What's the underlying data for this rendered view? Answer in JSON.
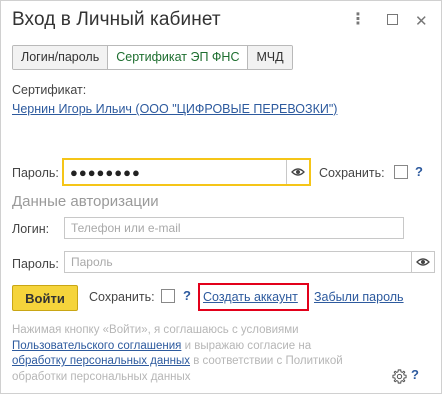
{
  "window": {
    "title": "Вход в Личный кабинет",
    "menu_glyph": "⋮",
    "close_glyph": "✕"
  },
  "tabs": [
    {
      "label": "Логин/пароль",
      "active": false
    },
    {
      "label": "Сертификат ЭП ФНС",
      "active": true
    },
    {
      "label": "МЧД",
      "active": false
    }
  ],
  "certificate": {
    "label": "Сертификат:",
    "value": "Чернин Игорь Ильич (ООО \"ЦИФРОВЫЕ ПЕРЕВОЗКИ\")"
  },
  "cert_password": {
    "label": "Пароль:",
    "masked_value": "●●●●●●●●",
    "save_label": "Сохранить:",
    "help": "?"
  },
  "auth": {
    "section_title": "Данные авторизации",
    "login_label": "Логин:",
    "login_placeholder": "Телефон или e-mail",
    "password_label": "Пароль:",
    "password_placeholder": "Пароль"
  },
  "actions": {
    "login_button": "Войти",
    "save_label": "Сохранить:",
    "help": "?",
    "create_account": "Создать аккаунт",
    "forgot_password": "Забыли пароль"
  },
  "consent": {
    "text1": "Нажимая кнопку «Войти», я соглашаюсь с условиями",
    "link1": "Пользовательского соглашения",
    "text2": " и выражаю согласие на",
    "link2": "обработку персональных данных",
    "text3": " в соответствии с Политикой обработки персональных данных"
  },
  "footer": {
    "help": "?"
  },
  "colors": {
    "accent_yellow": "#f5d43b",
    "link_blue": "#2d5a9e",
    "active_tab_green": "#1d6e2f",
    "highlight_red": "#e2001a"
  }
}
